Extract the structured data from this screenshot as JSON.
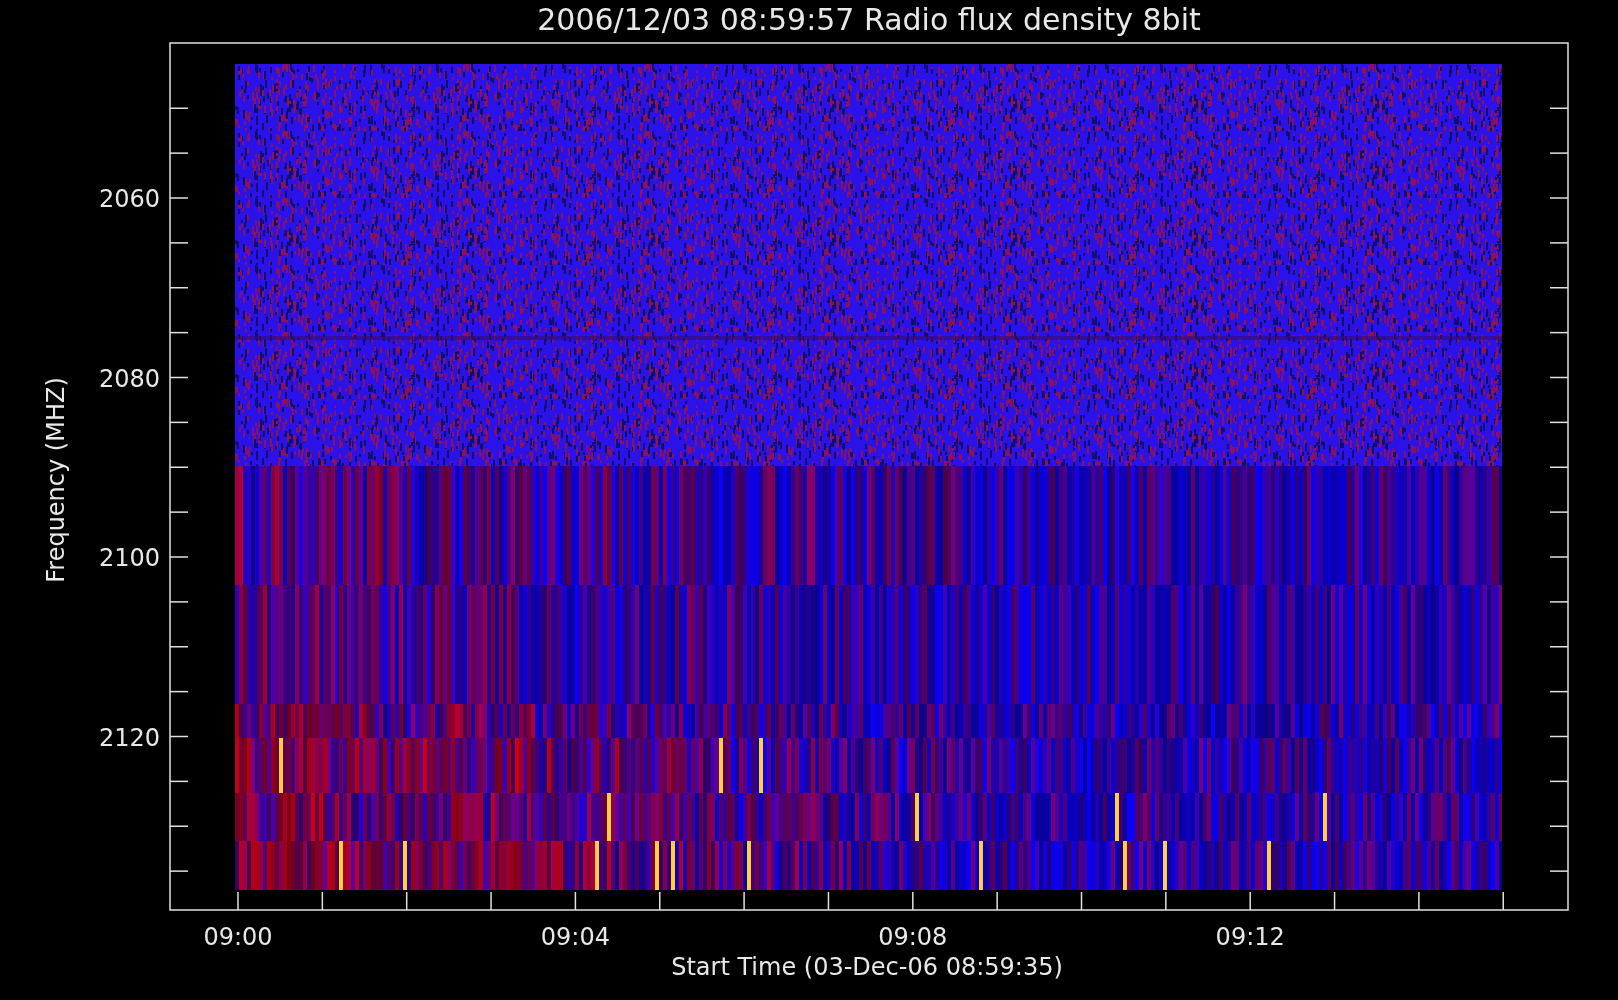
{
  "title": "2006/12/03 08:59:57 Radio flux density 8bit",
  "y_axis": {
    "label": "Frequency (MHZ)",
    "ticks": [
      "2060",
      "2080",
      "2100",
      "2120"
    ]
  },
  "x_axis": {
    "label": "Start Time (03-Dec-06 08:59:35)",
    "ticks": [
      "09:00",
      "09:04",
      "09:08",
      "09:12"
    ]
  }
}
